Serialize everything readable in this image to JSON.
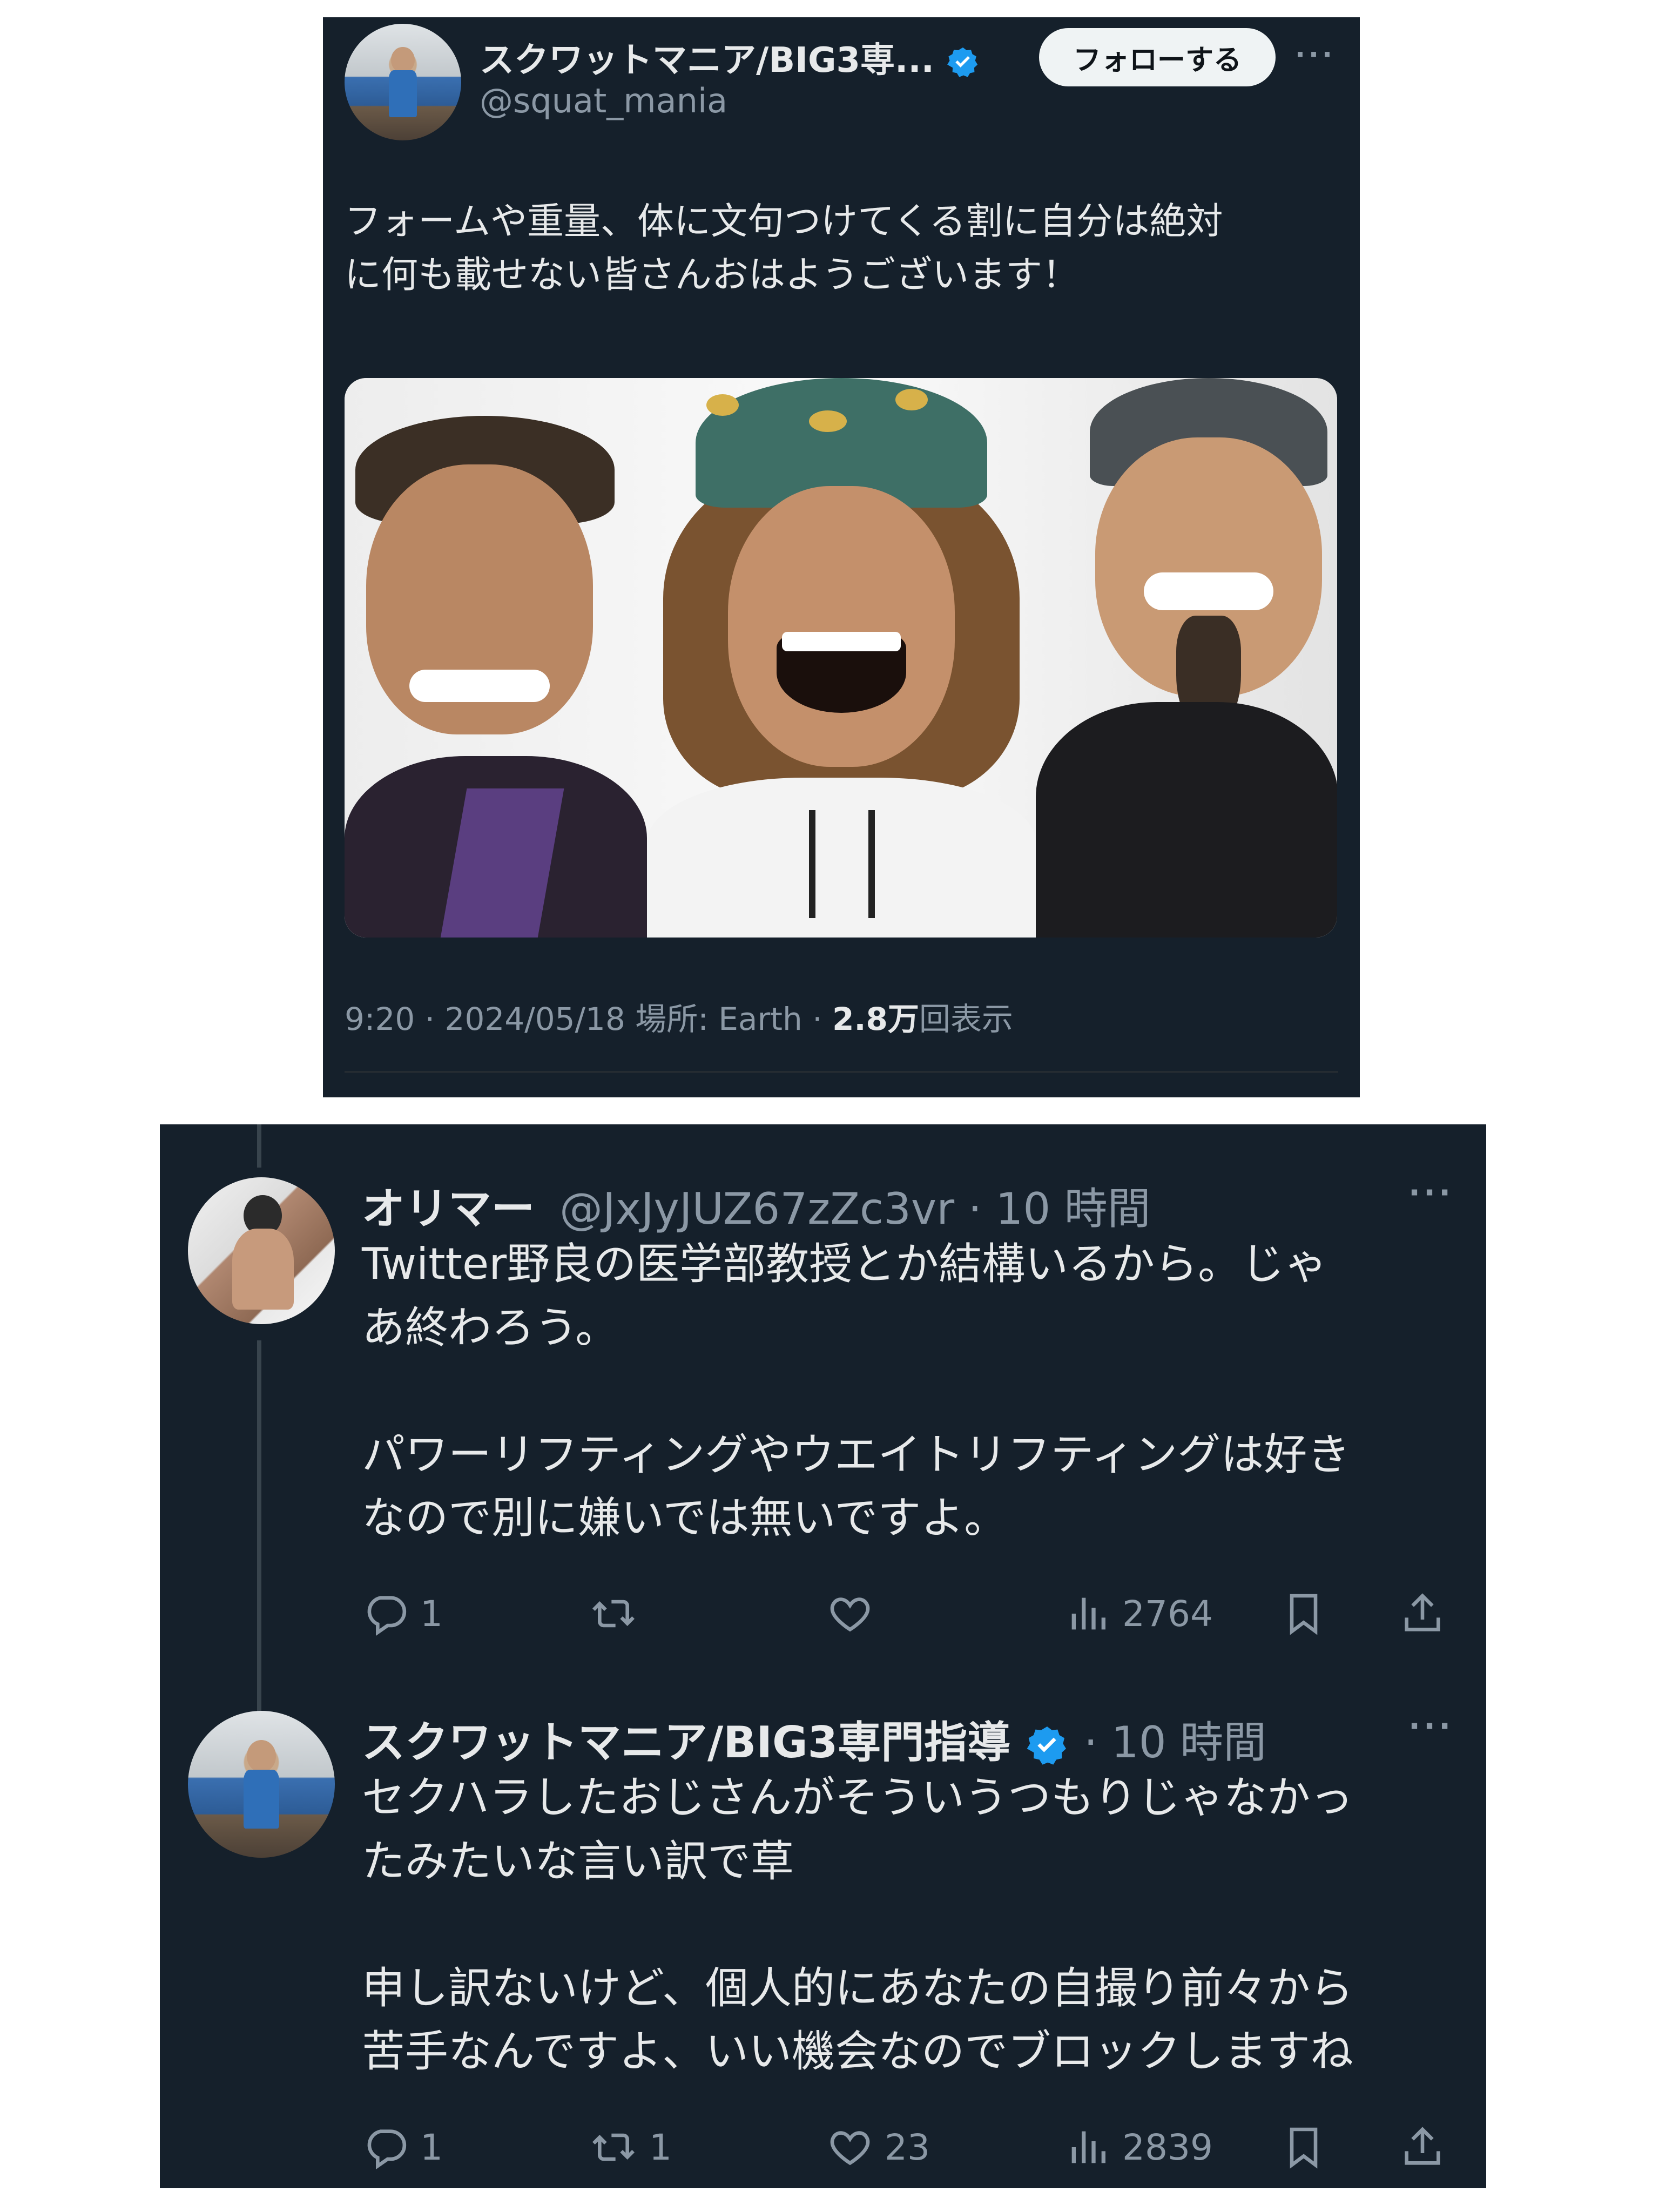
{
  "tweet": {
    "author_name": "スクワットマニア/BIG3専...",
    "author_handle": "@squat_mania",
    "follow_label": "フォローする",
    "more_label": "···",
    "text": "フォームや重量、体に文句つけてくる割に自分は絶対\nに何も載せない皆さんおはようございます！",
    "time": "9:20 · 2024/05/18 場所: Earth · ",
    "views_count": "2.8万",
    "views_suffix": "回表示"
  },
  "replies": [
    {
      "author_name": "オリマー",
      "author_handle": "@JxJyJUZ67zZc3vr",
      "time": "· 10 時間",
      "more_label": "···",
      "text": "Twitter野良の医学部教授とか結構いるから。じゃ\nあ終わろう。\n\nパワーリフティングやウエイトリフティングは好き\nなので別に嫌いでは無いですよ。",
      "reply_count": "1",
      "retweet_count": "",
      "like_count": "",
      "view_count": "2764"
    },
    {
      "author_name": "スクワットマニア/BIG3専門指導",
      "time": "· 10 時間",
      "more_label": "···",
      "text": "セクハラしたおじさんがそういうつもりじゃなかっ\nたみたいな言い訳で草\n\n申し訳ないけど、個人的にあなたの自撮り前々から\n苦手なんですよ、いい機会なのでブロックしますね",
      "reply_count": "1",
      "retweet_count": "1",
      "like_count": "23",
      "view_count": "2839"
    }
  ],
  "icons": {
    "verified": "verified-badge-icon",
    "reply": "reply-icon",
    "retweet": "retweet-icon",
    "like": "heart-icon",
    "views": "views-chart-icon",
    "bookmark": "bookmark-icon",
    "share": "share-icon"
  },
  "colors": {
    "background": "#15202b",
    "text": "#e7e9ea",
    "secondary": "#8b98a5",
    "verified": "#1d9bf0"
  }
}
